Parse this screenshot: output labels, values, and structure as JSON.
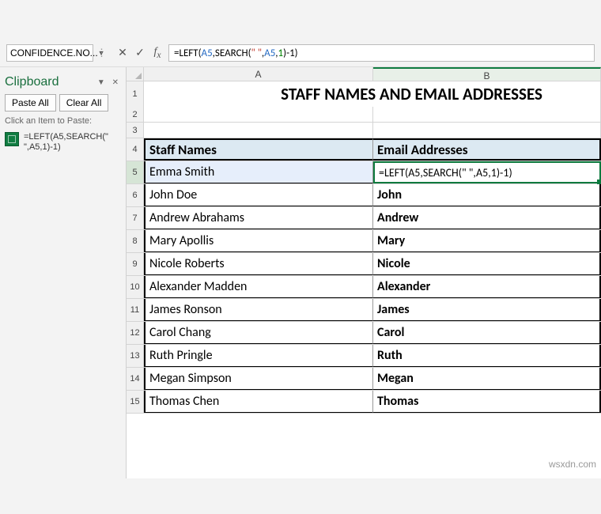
{
  "namebox": "CONFIDENCE.NO...",
  "formula_segments": {
    "a": "=LEFT(",
    "b": "A5",
    "c": ",SEARCH(",
    "d": "\" \"",
    "e": ",",
    "f": "A5",
    "g": ",",
    "h": "1",
    "i": ")-1)"
  },
  "clipboard": {
    "title": "Clipboard",
    "paste_all": "Paste All",
    "clear_all": "Clear All",
    "hint": "Click an Item to Paste:",
    "item": "=LEFT(A5,SEARCH(\" \",A5,1)-1)"
  },
  "cols": {
    "A": "A",
    "B": "B"
  },
  "title_row": "STAFF NAMES AND EMAIL ADDRESSES",
  "headers": {
    "a": "Staff Names",
    "b": "Email Addresses"
  },
  "rows": [
    {
      "n": "5",
      "a": "Emma Smith",
      "b": "=LEFT(A5,SEARCH(|\" \",A5,1)-1)"
    },
    {
      "n": "6",
      "a": "John Doe",
      "b": "John"
    },
    {
      "n": "7",
      "a": "Andrew Abrahams",
      "b": "Andrew"
    },
    {
      "n": "8",
      "a": "Mary Apollis",
      "b": "Mary"
    },
    {
      "n": "9",
      "a": "Nicole Roberts",
      "b": "Nicole"
    },
    {
      "n": "10",
      "a": "Alexander Madden",
      "b": "Alexander"
    },
    {
      "n": "11",
      "a": "James Ronson",
      "b": "James"
    },
    {
      "n": "12",
      "a": "Carol Chang",
      "b": "Carol"
    },
    {
      "n": "13",
      "a": "Ruth Pringle",
      "b": "Ruth"
    },
    {
      "n": "14",
      "a": "Megan Simpson",
      "b": "Megan"
    },
    {
      "n": "15",
      "a": "Thomas Chen",
      "b": "Thomas"
    }
  ],
  "watermark": "wsxdn.com"
}
